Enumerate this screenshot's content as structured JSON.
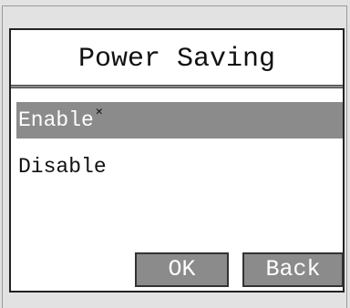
{
  "dialog": {
    "title": "Power Saving",
    "options": [
      {
        "label": "Enable",
        "selected": true,
        "marker_icon": "cursor-x-icon",
        "marker_glyph": "✕"
      },
      {
        "label": "Disable",
        "selected": false
      }
    ],
    "buttons": {
      "ok": "OK",
      "back": "Back"
    }
  },
  "colors": {
    "background": "#e2e2e2",
    "dialog": "#ffffff",
    "selection": "#8b8b8b",
    "button": "#8b8b8b",
    "text": "#111111"
  }
}
